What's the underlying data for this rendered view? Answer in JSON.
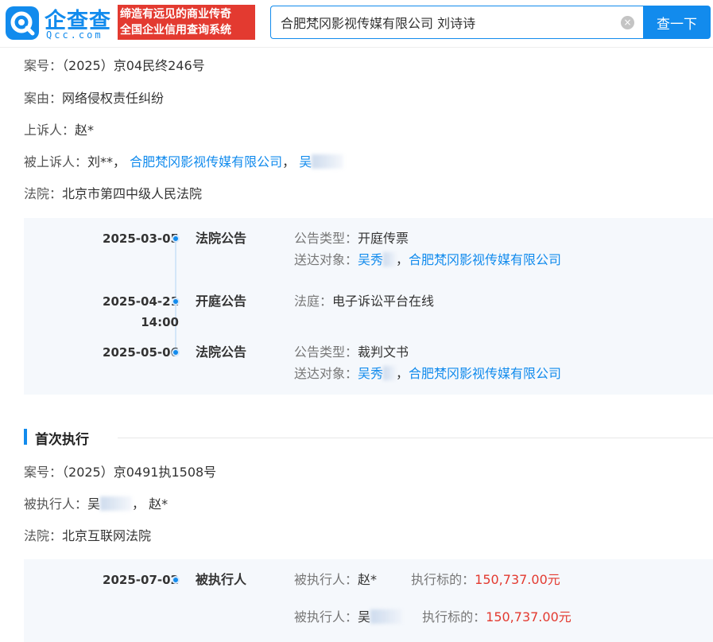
{
  "header": {
    "logo_text": "企查查",
    "logo_sub": "Qcc.com",
    "slogan_line1": "缔造有远见的商业传奇",
    "slogan_line2": "全国企业信用查询系统",
    "search_value": "合肥梵冈影视传媒有限公司 刘诗诗",
    "search_button": "查一下",
    "clear_glyph": "×"
  },
  "case1": {
    "case_no_label": "案号：",
    "case_no": "（2025）京04民终246号",
    "cause_label": "案由：",
    "cause": "网络侵权责任纠纷",
    "appellant_label": "上诉人：",
    "appellant": "赵*",
    "appellee_label": "被上诉人：",
    "appellee_person": "刘**，",
    "appellee_company": "合肥梵冈影视传媒有限公司",
    "appellee_sep": "，",
    "appellee_other": "吴",
    "court_label": "法院：",
    "court": "北京市第四中级人民法院"
  },
  "timeline1": [
    {
      "date": "2025-03-05",
      "type": "法院公告",
      "line1_label": "公告类型：",
      "line1_value": "开庭传票",
      "line2_label": "送达对象：",
      "line2_value": "吴秀",
      "line2_sep": "，",
      "line2_link": "合肥梵冈影视传媒有限公司"
    },
    {
      "date": "2025-04-21",
      "time": "14:00",
      "type": "开庭公告",
      "line1_label": "法庭：",
      "line1_value": "电子诉讼平台在线"
    },
    {
      "date": "2025-05-06",
      "type": "法院公告",
      "line1_label": "公告类型：",
      "line1_value": "裁判文书",
      "line2_label": "送达对象：",
      "line2_value": "吴秀",
      "line2_sep": "，",
      "line2_link": "合肥梵冈影视传媒有限公司"
    }
  ],
  "section2": {
    "title": "首次执行",
    "case_no_label": "案号：",
    "case_no": "（2025）京0491执1508号",
    "executed_label": "被执行人：",
    "executed_1": "吴",
    "executed_sep": "，",
    "executed_2": "赵*",
    "court_label": "法院：",
    "court": "北京互联网法院"
  },
  "timeline2": {
    "date": "2025-07-02",
    "type": "被执行人",
    "rows": [
      {
        "party_label": "被执行人：",
        "party": "赵*",
        "amount_label": "执行标的：",
        "amount": "150,737.00元"
      },
      {
        "party_label": "被执行人：",
        "party": "吴",
        "amount_label": "执行标的：",
        "amount": "150,737.00元"
      }
    ]
  },
  "colors": {
    "brand": "#128bed",
    "slogan_bg": "#e33a30",
    "amount": "#e33a30",
    "panel_bg": "#f5f8fc"
  }
}
